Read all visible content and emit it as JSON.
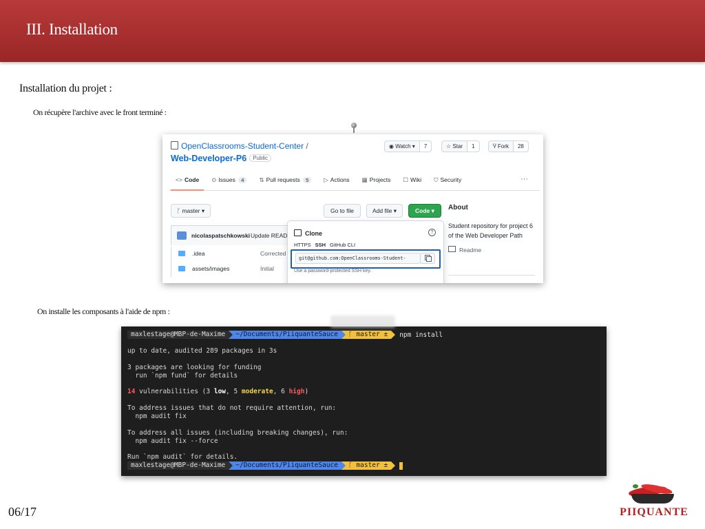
{
  "header": {
    "title": "III.  Installation"
  },
  "content": {
    "heading": "Installation du projet :",
    "step1": "On récupère l'archive avec le front terminé :",
    "step2": "On installe les composants à l'aide de npm :"
  },
  "github": {
    "org": "OpenClassrooms-Student-Center",
    "separator": "/",
    "repo": "Web-Developer-P6",
    "visibility": "Public",
    "watch_label": "Watch",
    "watch_count": "7",
    "star_label": "Star",
    "star_count": "1",
    "fork_label": "Fork",
    "fork_count": "28",
    "tabs": [
      {
        "icon": "<>",
        "label": "Code",
        "count": ""
      },
      {
        "icon": "⊙",
        "label": "Issues",
        "count": "4"
      },
      {
        "icon": "⇅",
        "label": "Pull requests",
        "count": "5"
      },
      {
        "icon": "▷",
        "label": "Actions",
        "count": ""
      },
      {
        "icon": "▦",
        "label": "Projects",
        "count": ""
      },
      {
        "icon": "☐",
        "label": "Wiki",
        "count": ""
      },
      {
        "icon": "⛉",
        "label": "Security",
        "count": ""
      }
    ],
    "more": "···",
    "branch": "master",
    "goto_file": "Go to file",
    "add_file": "Add file",
    "code_button": "Code",
    "commit_author": "nicolaspatschkowski",
    "commit_message": "Update READ",
    "files": [
      {
        "name": ".idea",
        "message": "Corrected"
      },
      {
        "name": "assets/images",
        "message": "Initial"
      }
    ],
    "clone": {
      "title": "Clone",
      "tabs": [
        "HTTPS",
        "SSH",
        "GitHub CLI"
      ],
      "selected_tab": "SSH",
      "url": "git@github.com:OpenClassrooms-Student-",
      "hint": "Use a password-protected SSH key."
    },
    "about": {
      "heading": "About",
      "description": "Student repository for project 6 of the Web Developer Path",
      "readme": "Readme"
    }
  },
  "terminal": {
    "user": "maxlestage@MBP-de-Maxime",
    "path": "~/Documents/PiiquanteSauce",
    "branch": "master ±",
    "command": "npm install",
    "lines": [
      "up to date, audited 289 packages in 3s",
      "3 packages are looking for funding",
      "  run `npm fund` for details",
      "To address issues that do not require attention, run:",
      "  npm audit fix",
      "To address all issues (including breaking changes), run:",
      "  npm audit fix --force",
      "Run `npm audit` for details."
    ],
    "vuln": {
      "count": "14",
      "text_a": " vulnerabilities (3 ",
      "low": "low",
      "text_b": ", 5 ",
      "moderate": "moderate",
      "text_c": ", 6 ",
      "high": "high",
      "text_d": ")"
    }
  },
  "footer": {
    "page": "06/17",
    "brand": "PIIQUANTE"
  },
  "colors": {
    "header_red": "#a82e2e",
    "brand_red": "#b12121",
    "github_link": "#0969da",
    "code_green": "#2da44e",
    "prompt_blue": "#4f86e8",
    "prompt_yellow": "#f0c040"
  }
}
